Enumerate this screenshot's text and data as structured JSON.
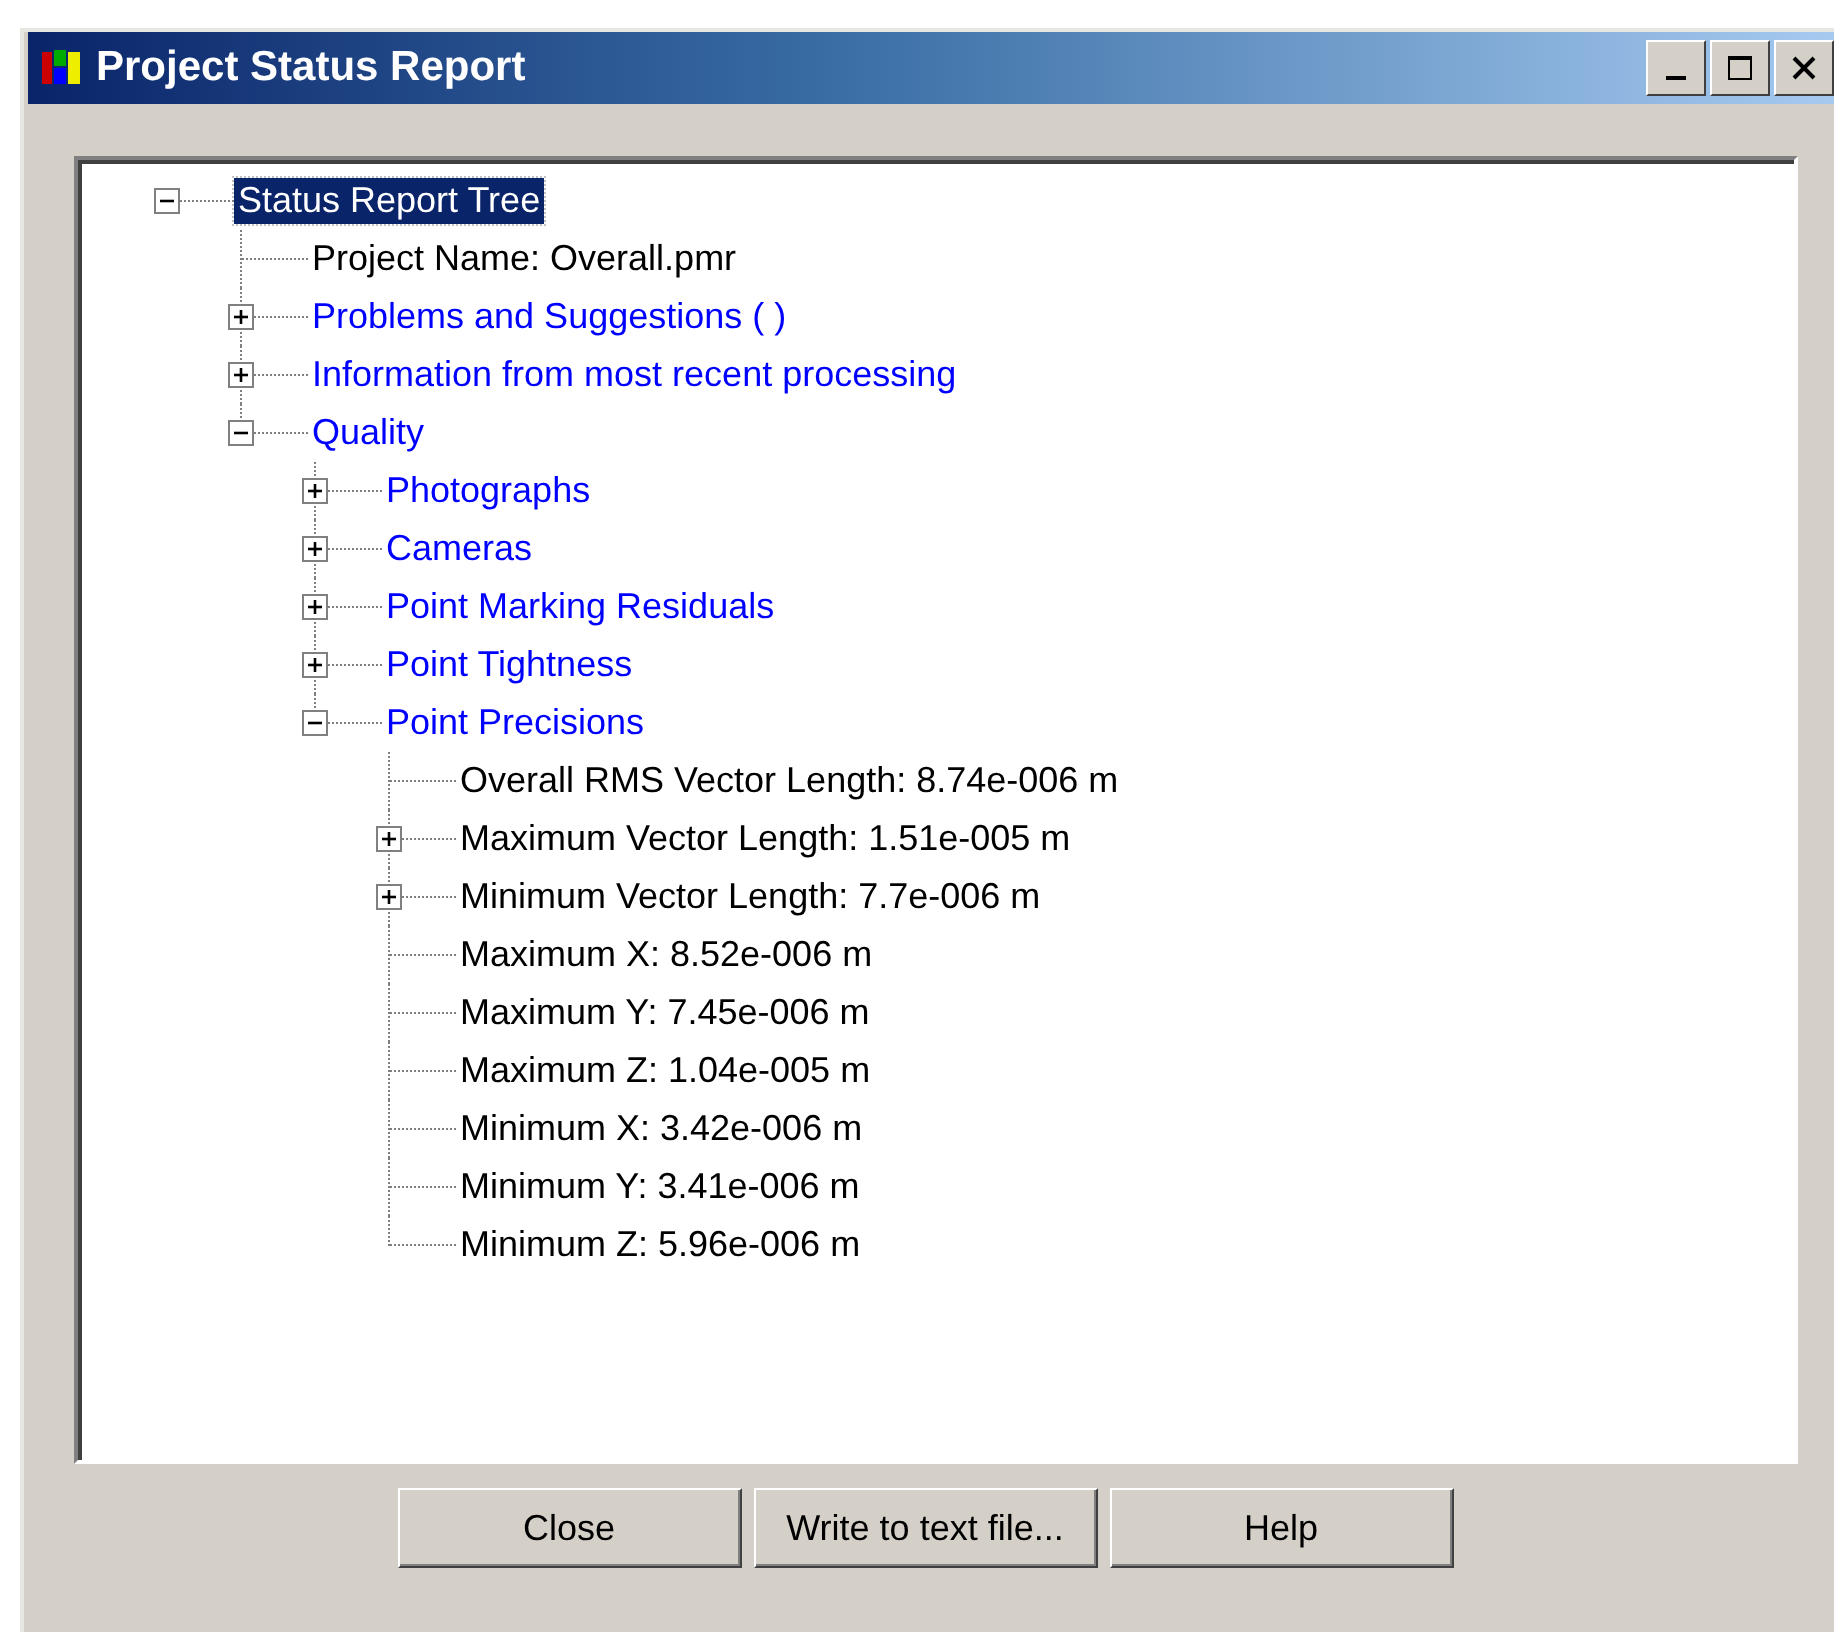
{
  "window": {
    "title": "Project Status Report"
  },
  "tree": [
    {
      "text": "Status Report Tree",
      "kind": "category",
      "selected": true,
      "expanded": true,
      "children": [
        {
          "text": "Project Name:  Overall.pmr",
          "kind": "value",
          "selected": false
        },
        {
          "text": "Problems and Suggestions ( )",
          "kind": "category",
          "selected": false,
          "expanded": false
        },
        {
          "text": "Information from most recent processing",
          "kind": "category",
          "selected": false,
          "expanded": false
        },
        {
          "text": "Quality",
          "kind": "category",
          "selected": false,
          "expanded": true,
          "children": [
            {
              "text": "Photographs",
              "kind": "category",
              "selected": false,
              "expanded": false
            },
            {
              "text": "Cameras",
              "kind": "category",
              "selected": false,
              "expanded": false
            },
            {
              "text": "Point Marking Residuals",
              "kind": "category",
              "selected": false,
              "expanded": false
            },
            {
              "text": "Point Tightness",
              "kind": "category",
              "selected": false,
              "expanded": false
            },
            {
              "text": "Point Precisions",
              "kind": "category",
              "selected": false,
              "expanded": true,
              "children": [
                {
                  "text": "Overall RMS Vector Length: 8.74e-006 m",
                  "kind": "value",
                  "selected": false
                },
                {
                  "text": "Maximum Vector Length: 1.51e-005 m",
                  "kind": "value",
                  "selected": false,
                  "expanded": false
                },
                {
                  "text": "Minimum Vector Length: 7.7e-006 m",
                  "kind": "value",
                  "selected": false,
                  "expanded": false
                },
                {
                  "text": "Maximum X: 8.52e-006 m",
                  "kind": "value",
                  "selected": false
                },
                {
                  "text": "Maximum Y: 7.45e-006 m",
                  "kind": "value",
                  "selected": false
                },
                {
                  "text": "Maximum Z: 1.04e-005 m",
                  "kind": "value",
                  "selected": false
                },
                {
                  "text": "Minimum X: 3.42e-006 m",
                  "kind": "value",
                  "selected": false
                },
                {
                  "text": "Minimum Y: 3.41e-006 m",
                  "kind": "value",
                  "selected": false
                },
                {
                  "text": "Minimum Z: 5.96e-006 m",
                  "kind": "value",
                  "selected": false
                }
              ]
            }
          ]
        }
      ]
    }
  ],
  "buttons": [
    {
      "label": "Close"
    },
    {
      "label": "Write to text file..."
    },
    {
      "label": "Help"
    }
  ]
}
